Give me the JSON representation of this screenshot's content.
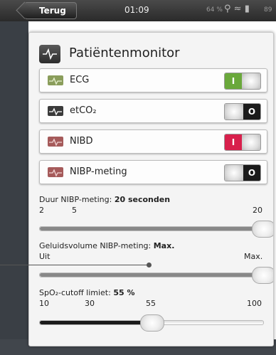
{
  "status_bar": {
    "back_label": "Terug",
    "time": "01:09",
    "battery_pct": "64 %",
    "extra": "89"
  },
  "panel": {
    "title": "Patiëntenmonitor"
  },
  "rows": [
    {
      "label": "ECG",
      "state": "I",
      "on": true,
      "on_color": "#6aa83b"
    },
    {
      "label": "etCO₂",
      "state": "O",
      "on": false
    },
    {
      "label": "NIBD",
      "state": "I",
      "on": true,
      "on_color": "#d8204c"
    },
    {
      "label": "NIBP-meting",
      "state": "O",
      "on": false
    }
  ],
  "sliders": [
    {
      "label": "Duur NIBP-meting:",
      "value": "20 seconden",
      "ticks": [
        "2",
        "5",
        "20"
      ],
      "fraction": 1.0
    },
    {
      "label": "Geluidsvolume NIBP-meting:",
      "value": "Max.",
      "ticks": [
        "Uit",
        "Max."
      ],
      "fraction": 1.0
    },
    {
      "label": "SpO₂-cutoff limiet:",
      "value": "55 %",
      "ticks": [
        "10",
        "30",
        "55",
        "100"
      ],
      "fraction": 0.5
    }
  ],
  "colors": {
    "accent_green": "#6aa83b",
    "accent_red": "#d8204c",
    "off_dark": "#1b1b1b"
  }
}
